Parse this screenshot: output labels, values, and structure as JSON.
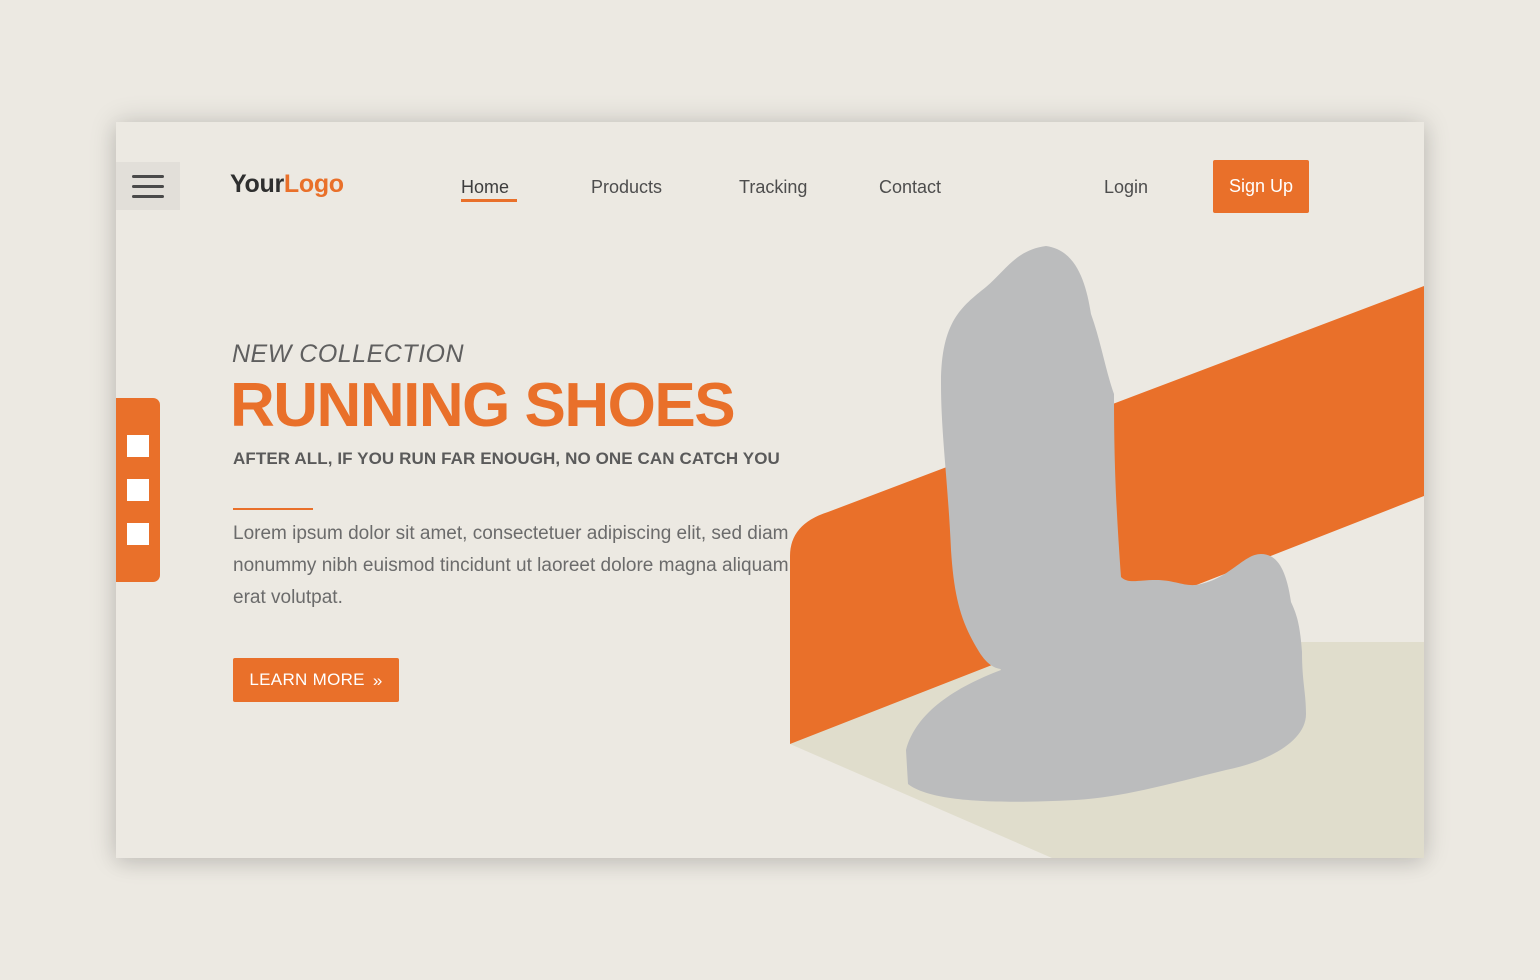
{
  "logo": {
    "part1": "Your",
    "part2": "Logo"
  },
  "nav": {
    "items": [
      {
        "label": "Home",
        "active": true
      },
      {
        "label": "Products",
        "active": false
      },
      {
        "label": "Tracking",
        "active": false
      },
      {
        "label": "Contact",
        "active": false
      }
    ],
    "login": "Login",
    "signup": "Sign Up"
  },
  "hero": {
    "eyebrow": "NEW COLLECTION",
    "title": "RUNNING SHOES",
    "tagline": "AFTER ALL, IF YOU RUN FAR ENOUGH, NO ONE CAN CATCH YOU",
    "body": "Lorem ipsum dolor sit amet, consectetuer adipiscing elit, sed diam nonummy nibh euismod tincidunt ut laoreet dolore magna aliquam erat volutpat.",
    "cta": "LEARN MORE",
    "cta_icon": "»"
  },
  "icons": {
    "menu": "hamburger-menu-icon",
    "cta": "double-chevron-right-icon",
    "illustration": "shoe-silhouette"
  },
  "colors": {
    "accent": "#e9702a",
    "background": "#ece9e2",
    "shoe": "#bbbcbd",
    "shadow": "#e0ddcc",
    "text": "#4d4d4d"
  }
}
